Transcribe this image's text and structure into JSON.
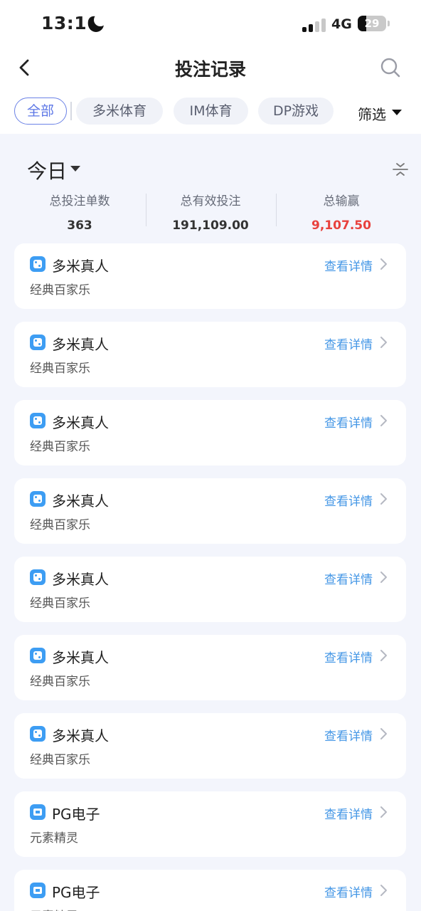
{
  "status_bar": {
    "time": "13:16",
    "network": "4G",
    "battery": "29",
    "battery_level": 0.29,
    "moon_icon": "moon-icon"
  },
  "header": {
    "title": "投注记录",
    "back_icon": "chevron-left-icon",
    "search_icon": "search-icon"
  },
  "tabs": [
    {
      "label": "全部",
      "active": true
    },
    {
      "label": "多米体育",
      "active": false
    },
    {
      "label": "IM体育",
      "active": false
    },
    {
      "label": "DP游戏",
      "active": false
    }
  ],
  "filter": {
    "label": "筛选"
  },
  "summary": {
    "date_label": "今日",
    "stats": [
      {
        "label": "总投注单数",
        "value": "363"
      },
      {
        "label": "总有效投注",
        "value": "191,109.00"
      },
      {
        "label": "总输赢",
        "value": "9,107.50",
        "color": "#e8413d"
      }
    ]
  },
  "records": [
    {
      "provider": "多米真人",
      "game": "经典百家乐",
      "link": "查看详情",
      "icon": "dice-icon"
    },
    {
      "provider": "多米真人",
      "game": "经典百家乐",
      "link": "查看详情",
      "icon": "dice-icon"
    },
    {
      "provider": "多米真人",
      "game": "经典百家乐",
      "link": "查看详情",
      "icon": "dice-icon"
    },
    {
      "provider": "多米真人",
      "game": "经典百家乐",
      "link": "查看详情",
      "icon": "dice-icon"
    },
    {
      "provider": "多米真人",
      "game": "经典百家乐",
      "link": "查看详情",
      "icon": "dice-icon"
    },
    {
      "provider": "多米真人",
      "game": "经典百家乐",
      "link": "查看详情",
      "icon": "dice-icon"
    },
    {
      "provider": "多米真人",
      "game": "经典百家乐",
      "link": "查看详情",
      "icon": "dice-icon"
    },
    {
      "provider": "PG电子",
      "game": "元素精灵",
      "link": "查看详情",
      "icon": "slot-machine-icon"
    },
    {
      "provider": "PG电子",
      "game": "元素精灵",
      "link": "查看详情",
      "icon": "slot-machine-icon"
    }
  ],
  "colors": {
    "accent": "#5d77e6",
    "link": "#4597e6",
    "loss_win": "#e8413d",
    "icon_bg": "#3d9df3"
  }
}
